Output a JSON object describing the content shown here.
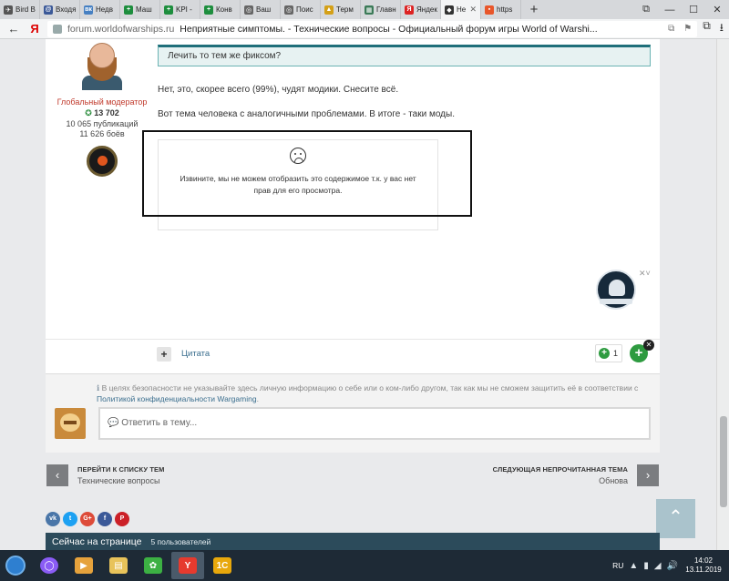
{
  "browser": {
    "tabs": [
      {
        "label": "Bird B",
        "color": "#555555",
        "glyph": "✈"
      },
      {
        "label": "Входя",
        "color": "#3b5998",
        "glyph": "@"
      },
      {
        "label": "Недв",
        "color": "#4680c2",
        "glyph": "вк"
      },
      {
        "label": "Маш",
        "color": "#1e8e3e",
        "glyph": "+"
      },
      {
        "label": "KPI -",
        "color": "#1e8e3e",
        "glyph": "+"
      },
      {
        "label": "Конв",
        "color": "#1e8e3e",
        "glyph": "+"
      },
      {
        "label": "Ваш",
        "color": "#666666",
        "glyph": "◎"
      },
      {
        "label": "Поис",
        "color": "#666666",
        "glyph": "◎"
      },
      {
        "label": "Терм",
        "color": "#d4a017",
        "glyph": "▲"
      },
      {
        "label": "Главн",
        "color": "#3b7a57",
        "glyph": "▦"
      },
      {
        "label": "Яндек",
        "color": "#dd2222",
        "glyph": "Я"
      },
      {
        "label": "Не",
        "color": "#333333",
        "glyph": "◆"
      },
      {
        "label": "https",
        "color": "#e8562a",
        "glyph": "▪"
      }
    ],
    "new_tab": "+",
    "window_controls": [
      "⧉",
      "—",
      "☐",
      "✕"
    ],
    "back": "←",
    "yandex": "Я",
    "host": "forum.worldofwarships.ru",
    "page_title": "Неприятные симптомы. - Технические вопросы - Официальный форум игры World of Warshi...",
    "url_tools": [
      "⧉",
      "⚑"
    ],
    "right_icons": [
      "⧉",
      "⭳"
    ]
  },
  "post": {
    "author": {
      "role": "Глобальный модератор",
      "reputation_icon": "✪",
      "reputation": "13 702",
      "publications": "10 065 публикаций",
      "battles": "11 626 боёв"
    },
    "quote": "Лечить то тем же фиксом?",
    "text1": "Нет, это, скорее всего (99%), чудят модики. Снесите всё.",
    "text2": "Вот тема человека с аналогичными проблемами. В итоге - таки моды.",
    "embed_message": "Извините, мы не можем отобразить это содержимое т.к. у вас нет прав для его просмотра.",
    "ad_close": "✕˅",
    "footer": {
      "plus": "+",
      "quote_label": "Цитата",
      "rep_plus": "+",
      "rep_count": "1",
      "big_plus": "+",
      "close": "✕"
    }
  },
  "reply": {
    "notice_icon": "ℹ",
    "notice": "В целях безопасности не указывайте здесь личную информацию о себе или о ком-либо другом, так как мы не сможем защитить её в соответствии с",
    "notice_link": "Политикой конфиденциальности Wargaming",
    "notice_end": ".",
    "placeholder": "💬 Ответить в тему..."
  },
  "navigation": {
    "prev_arrow": "‹",
    "prev_title": "ПЕРЕЙТИ К СПИСКУ ТЕМ",
    "prev_sub": "Технические вопросы",
    "next_title": "СЛЕДУЮЩАЯ НЕПРОЧИТАННАЯ ТЕМА",
    "next_sub": "Обнова",
    "next_arrow": "›"
  },
  "social": [
    {
      "name": "vk-icon",
      "glyph": "vk",
      "color": "#4a76a8"
    },
    {
      "name": "twitter-icon",
      "glyph": "t",
      "color": "#1da1f2"
    },
    {
      "name": "google-plus-icon",
      "glyph": "G+",
      "color": "#dd4b39"
    },
    {
      "name": "facebook-icon",
      "glyph": "f",
      "color": "#3b5998"
    },
    {
      "name": "pinterest-icon",
      "glyph": "P",
      "color": "#cb2027"
    }
  ],
  "to_top": "⌃",
  "online": {
    "title": "Сейчас на странице",
    "count": "5 пользователей"
  },
  "taskbar": {
    "apps": [
      {
        "name": "alice-icon",
        "glyph": "◯",
        "color": "#8a5cf5"
      },
      {
        "name": "media-player-icon",
        "glyph": "▶",
        "color": "#e6a23c"
      },
      {
        "name": "explorer-icon",
        "glyph": "▤",
        "color": "#e8c35a"
      },
      {
        "name": "icq-icon",
        "glyph": "✿",
        "color": "#3cb043"
      },
      {
        "name": "yandex-browser-icon",
        "glyph": "Y",
        "color": "#e63a2e"
      },
      {
        "name": "1c-icon",
        "glyph": "1С",
        "color": "#e8a80c"
      }
    ],
    "lang": "RU",
    "tray_icons": [
      "▲",
      "▮",
      "◢",
      "🔊"
    ],
    "time": "14:02",
    "date": "13.11.2019"
  }
}
